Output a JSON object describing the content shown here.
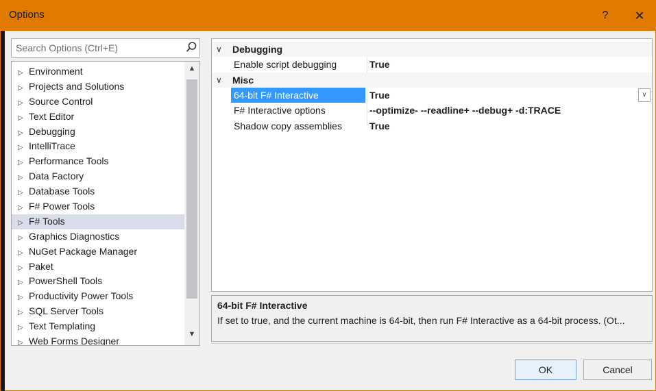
{
  "window": {
    "title": "Options",
    "help_label": "?",
    "close_label": "✕",
    "accent_color": "#e07a00"
  },
  "search": {
    "placeholder": "Search Options (Ctrl+E)",
    "icon": "search-icon"
  },
  "tree": {
    "items": [
      {
        "label": "Environment"
      },
      {
        "label": "Projects and Solutions"
      },
      {
        "label": "Source Control"
      },
      {
        "label": "Text Editor"
      },
      {
        "label": "Debugging"
      },
      {
        "label": "IntelliTrace"
      },
      {
        "label": "Performance Tools"
      },
      {
        "label": "Data Factory"
      },
      {
        "label": "Database Tools"
      },
      {
        "label": "F# Power Tools"
      },
      {
        "label": "F# Tools"
      },
      {
        "label": "Graphics Diagnostics"
      },
      {
        "label": "NuGet Package Manager"
      },
      {
        "label": "Paket"
      },
      {
        "label": "PowerShell Tools"
      },
      {
        "label": "Productivity Power Tools"
      },
      {
        "label": "SQL Server Tools"
      },
      {
        "label": "Text Templating"
      },
      {
        "label": "Web Forms Designer"
      }
    ],
    "selected": "F# Tools"
  },
  "grid": {
    "categories": [
      {
        "label": "Debugging",
        "properties": [
          {
            "name": "Enable script debugging",
            "value": "True"
          }
        ]
      },
      {
        "label": "Misc",
        "properties": [
          {
            "name": "64-bit F# Interactive",
            "value": "True"
          },
          {
            "name": "F# Interactive options",
            "value": "--optimize- --readline+ --debug+ -d:TRACE"
          },
          {
            "name": "Shadow copy assemblies",
            "value": "True"
          }
        ]
      }
    ],
    "selected_property": "64-bit F# Interactive"
  },
  "description": {
    "title": "64-bit F# Interactive",
    "text": "If set to true, and the current machine is 64-bit, then run F# Interactive as a 64-bit process.  (Ot..."
  },
  "buttons": {
    "ok": "OK",
    "cancel": "Cancel"
  }
}
